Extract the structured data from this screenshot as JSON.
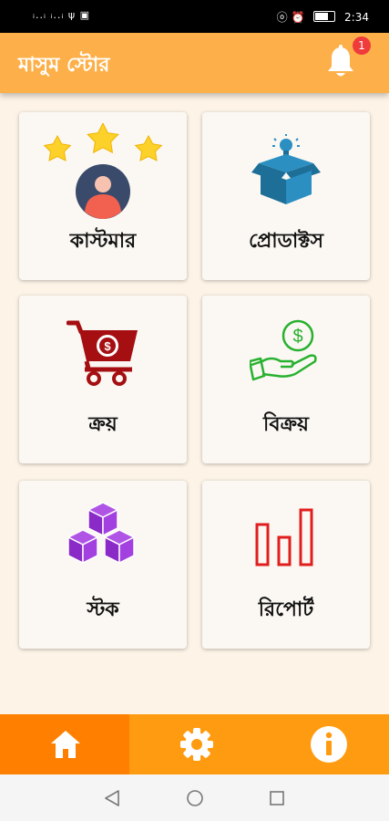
{
  "statusbar": {
    "signals": "ᵢ..ᵢ ᵢ..ᵢ ψ ▣",
    "right_icons": "ⓞ ⏰",
    "time": "2:34"
  },
  "appbar": {
    "title": "মাসুম স্টোর",
    "notification_count": "1"
  },
  "cards": [
    {
      "label": "কাস্টমার",
      "icon": "customer-rating-icon"
    },
    {
      "label": "প্রোডাক্টস",
      "icon": "product-box-icon"
    },
    {
      "label": "ক্রয়",
      "icon": "shopping-cart-dollar-icon"
    },
    {
      "label": "বিক্রয়",
      "icon": "hand-money-icon"
    },
    {
      "label": "স্টক",
      "icon": "stacked-boxes-icon"
    },
    {
      "label": "রিপোর্ট",
      "icon": "bar-chart-icon"
    }
  ],
  "bottom_nav": {
    "items": [
      "home-icon",
      "settings-icon",
      "info-icon"
    ],
    "active": "home"
  },
  "colors": {
    "appbar": "#fdb04a",
    "nav": "#ff9b10",
    "nav_active": "#ff8000",
    "background": "#fdf4e7"
  }
}
